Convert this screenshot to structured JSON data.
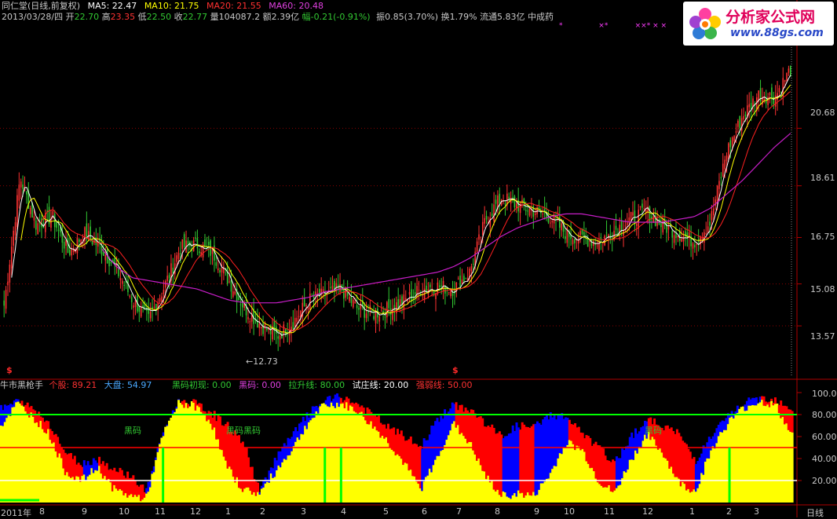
{
  "header": {
    "stock_name": "同仁堂(日线,前复权)",
    "ma5": "MA5: 22.47",
    "ma10": "MA10: 21.75",
    "ma20": "MA20: 21.55",
    "ma60": "MA60: 20.48",
    "date": "2013/03/28/四",
    "open_label": "开",
    "open": "22.70",
    "high_label": "高",
    "high": "23.35",
    "low_label": "低",
    "low": "22.50",
    "close_label": "收",
    "close": "22.77",
    "volume": "量104087.2",
    "amount": "额2.39亿",
    "change": "幅-0.21(-0.91%)",
    "amplitude": "振0.85(3.70%)",
    "turnover": "换1.79%",
    "float_cap": "流通5.83亿",
    "industry": "中成药"
  },
  "logo": {
    "title": "分析家公式网",
    "url": "www.88gs.com"
  },
  "indicator": {
    "name": "牛市黑枪手",
    "stock_label": "个股:",
    "stock_value": "89.21",
    "market_label": "大盘:",
    "market_value": "54.97",
    "heima_first_label": "黑码初现:",
    "heima_first_value": "0.00",
    "heima_label": "黑码:",
    "heima_value": "0.00",
    "lift_label": "拉升线:",
    "lift_value": "80.00",
    "test_label": "试庄线:",
    "test_value": "20.00",
    "weak_label": "强弱线:",
    "weak_value": "50.00",
    "heima_marks": [
      "黑码",
      "黑码",
      "黑码",
      "黑码"
    ]
  },
  "period_label": "日线",
  "low_marker": "12.73",
  "markers": [
    "$",
    "$"
  ],
  "colors": {
    "up": "#ff3232",
    "down": "#32c832",
    "ma5": "#ffffff",
    "ma10": "#ffff00",
    "ma20": "#ff2020",
    "ma60": "#c81ec8",
    "stock_fill": "#ffff00",
    "market_fill": "#ff0000",
    "blue_fill": "#0000ff",
    "lift": "#00ff00",
    "weak": "#ff0000",
    "test": "#ffffff"
  },
  "chart_data": [
    {
      "type": "candlestick",
      "title": "同仁堂(日线,前复权)",
      "y_ticks": [
        "20.68",
        "18.61",
        "16.75",
        "15.08",
        "13.57"
      ],
      "x_ticks": [
        "2011年",
        "8",
        "9",
        "10",
        "11",
        "12",
        "1",
        "2",
        "3",
        "4",
        "5",
        "6",
        "7",
        "8",
        "9",
        "10",
        "11",
        "12",
        "1",
        "2",
        "3"
      ],
      "close_path": [
        14.3,
        18.9,
        17.2,
        17.5,
        16.2,
        16.9,
        16.4,
        15.6,
        14.5,
        13.8,
        15.0,
        16.4,
        16.5,
        16.2,
        15.2,
        14.2,
        13.6,
        13.2,
        13.7,
        14.5,
        14.7,
        14.9,
        14.2,
        14.0,
        14.2,
        14.5,
        14.9,
        15.0,
        14.9,
        15.5,
        17.4,
        18.2,
        17.9,
        17.7,
        17.5,
        16.9,
        16.7,
        16.6,
        17.0,
        17.4,
        17.7,
        17.2,
        16.9,
        16.6,
        17.3,
        19.8,
        21.1,
        21.9,
        21.8,
        22.8
      ],
      "ma60_path": [
        null,
        null,
        null,
        null,
        null,
        null,
        16.4,
        15.7,
        15.3,
        15.2,
        15.1,
        15.0,
        14.9,
        14.7,
        14.5,
        14.4,
        14.4,
        14.4,
        14.5,
        14.6,
        14.8,
        14.9,
        15.0,
        15.1,
        15.2,
        15.3,
        15.4,
        15.5,
        15.7,
        16.0,
        16.4,
        16.8,
        17.1,
        17.3,
        17.5,
        17.6,
        17.6,
        17.5,
        17.4,
        17.3,
        17.3,
        17.3,
        17.4,
        17.5,
        17.8,
        18.3,
        18.8,
        19.4,
        20.0,
        20.5
      ],
      "low_annotation": 12.73,
      "last_close": 22.77
    },
    {
      "type": "area",
      "title": "牛市黑枪手",
      "y_ticks": [
        "100.0",
        "80.00",
        "60.00",
        "40.00",
        "20.00"
      ],
      "ylim": [
        0,
        100
      ],
      "series": [
        {
          "name": "个股",
          "values": [
            70,
            90,
            78,
            62,
            28,
            20,
            32,
            12,
            6,
            4,
            60,
            90,
            88,
            74,
            32,
            12,
            8,
            28,
            48,
            72,
            88,
            90,
            84,
            70,
            55,
            35,
            12,
            40,
            72,
            55,
            24,
            6,
            8,
            6,
            25,
            55,
            48,
            20,
            8,
            38,
            62,
            45,
            18,
            10,
            48,
            72,
            86,
            92,
            88,
            60
          ]
        },
        {
          "name": "大盘",
          "values": [
            85,
            92,
            85,
            72,
            45,
            35,
            40,
            30,
            25,
            10,
            62,
            92,
            90,
            82,
            70,
            55,
            10,
            40,
            60,
            80,
            92,
            96,
            90,
            80,
            68,
            60,
            50,
            75,
            88,
            85,
            72,
            60,
            70,
            68,
            80,
            78,
            62,
            50,
            35,
            60,
            75,
            70,
            62,
            38,
            60,
            78,
            90,
            95,
            94,
            85
          ]
        }
      ],
      "lines": {
        "拉升线": 80,
        "试庄线": 20,
        "强弱线": 50
      },
      "heima_positions": [
        10,
        20,
        21,
        45
      ]
    }
  ]
}
